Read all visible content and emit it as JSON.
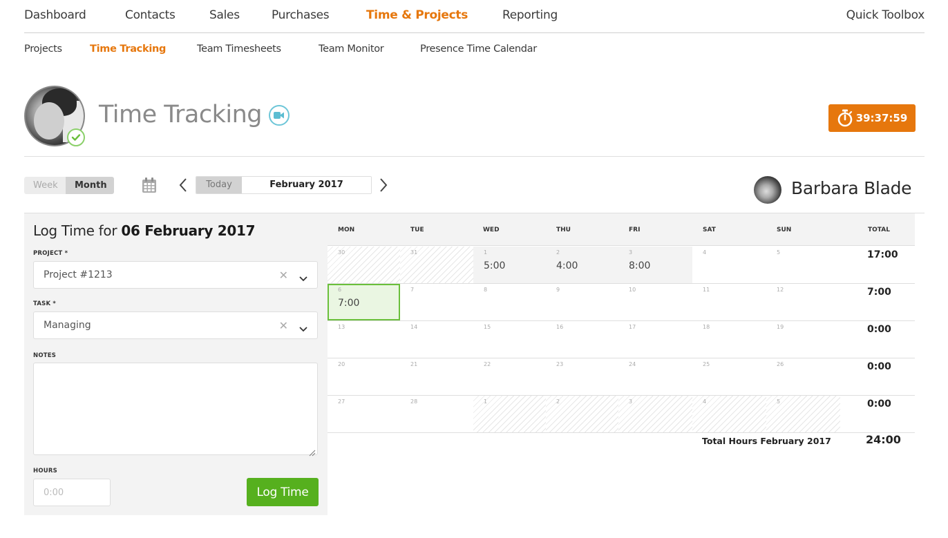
{
  "topnav": {
    "items": [
      {
        "label": "Dashboard",
        "active": false
      },
      {
        "label": "Contacts",
        "active": false
      },
      {
        "label": "Sales",
        "active": false
      },
      {
        "label": "Purchases",
        "active": false
      },
      {
        "label": "Time & Projects",
        "active": true
      },
      {
        "label": "Reporting",
        "active": false
      }
    ],
    "quick_toolbox": "Quick Toolbox"
  },
  "subnav": {
    "items": [
      {
        "label": "Projects",
        "active": false
      },
      {
        "label": "Time Tracking",
        "active": true
      },
      {
        "label": "Team Timesheets",
        "active": false
      },
      {
        "label": "Team Monitor",
        "active": false
      },
      {
        "label": "Presence Time Calendar",
        "active": false
      }
    ]
  },
  "header": {
    "title": "Time Tracking",
    "timer": "39:37:59",
    "accent_color": "#e6770d"
  },
  "toolbar": {
    "view_week": "Week",
    "view_month": "Month",
    "active_view": "Month",
    "today": "Today",
    "current_period": "February 2017",
    "user_name": "Barbara Blade"
  },
  "log": {
    "title_prefix": "Log Time for ",
    "title_date": "06 February 2017",
    "project_label": "PROJECT *",
    "project_value": "Project #1213",
    "task_label": "TASK *",
    "task_value": "Managing",
    "notes_label": "NOTES",
    "notes_value": "",
    "hours_label": "HOURS",
    "hours_placeholder": "0:00",
    "submit_label": "Log Time",
    "submit_color": "#56b01e"
  },
  "calendar": {
    "headers": [
      "MON",
      "TUE",
      "WED",
      "THU",
      "FRI",
      "SAT",
      "SUN",
      "TOTAL"
    ],
    "weeks": [
      {
        "total": "17:00",
        "days": [
          {
            "day": "30",
            "hours": "",
            "state": "outside"
          },
          {
            "day": "31",
            "hours": "",
            "state": "outside"
          },
          {
            "day": "1",
            "hours": "5:00",
            "state": "logged"
          },
          {
            "day": "2",
            "hours": "4:00",
            "state": "logged"
          },
          {
            "day": "3",
            "hours": "8:00",
            "state": "logged"
          },
          {
            "day": "4",
            "hours": "",
            "state": "normal"
          },
          {
            "day": "5",
            "hours": "",
            "state": "normal"
          }
        ]
      },
      {
        "total": "7:00",
        "days": [
          {
            "day": "6",
            "hours": "7:00",
            "state": "selected"
          },
          {
            "day": "7",
            "hours": "",
            "state": "normal"
          },
          {
            "day": "8",
            "hours": "",
            "state": "normal"
          },
          {
            "day": "9",
            "hours": "",
            "state": "normal"
          },
          {
            "day": "10",
            "hours": "",
            "state": "normal"
          },
          {
            "day": "11",
            "hours": "",
            "state": "normal"
          },
          {
            "day": "12",
            "hours": "",
            "state": "normal"
          }
        ]
      },
      {
        "total": "0:00",
        "days": [
          {
            "day": "13",
            "hours": "",
            "state": "normal"
          },
          {
            "day": "14",
            "hours": "",
            "state": "normal"
          },
          {
            "day": "15",
            "hours": "",
            "state": "normal"
          },
          {
            "day": "16",
            "hours": "",
            "state": "normal"
          },
          {
            "day": "17",
            "hours": "",
            "state": "normal"
          },
          {
            "day": "18",
            "hours": "",
            "state": "normal"
          },
          {
            "day": "19",
            "hours": "",
            "state": "normal"
          }
        ]
      },
      {
        "total": "0:00",
        "days": [
          {
            "day": "20",
            "hours": "",
            "state": "normal"
          },
          {
            "day": "21",
            "hours": "",
            "state": "normal"
          },
          {
            "day": "22",
            "hours": "",
            "state": "normal"
          },
          {
            "day": "23",
            "hours": "",
            "state": "normal"
          },
          {
            "day": "24",
            "hours": "",
            "state": "normal"
          },
          {
            "day": "25",
            "hours": "",
            "state": "normal"
          },
          {
            "day": "26",
            "hours": "",
            "state": "normal"
          }
        ]
      },
      {
        "total": "0:00",
        "days": [
          {
            "day": "27",
            "hours": "",
            "state": "normal"
          },
          {
            "day": "28",
            "hours": "",
            "state": "normal"
          },
          {
            "day": "1",
            "hours": "",
            "state": "outside"
          },
          {
            "day": "2",
            "hours": "",
            "state": "outside"
          },
          {
            "day": "3",
            "hours": "",
            "state": "outside"
          },
          {
            "day": "4",
            "hours": "",
            "state": "outside"
          },
          {
            "day": "5",
            "hours": "",
            "state": "outside"
          }
        ]
      }
    ],
    "grand_total_label": "Total Hours February 2017",
    "grand_total": "24:00"
  }
}
